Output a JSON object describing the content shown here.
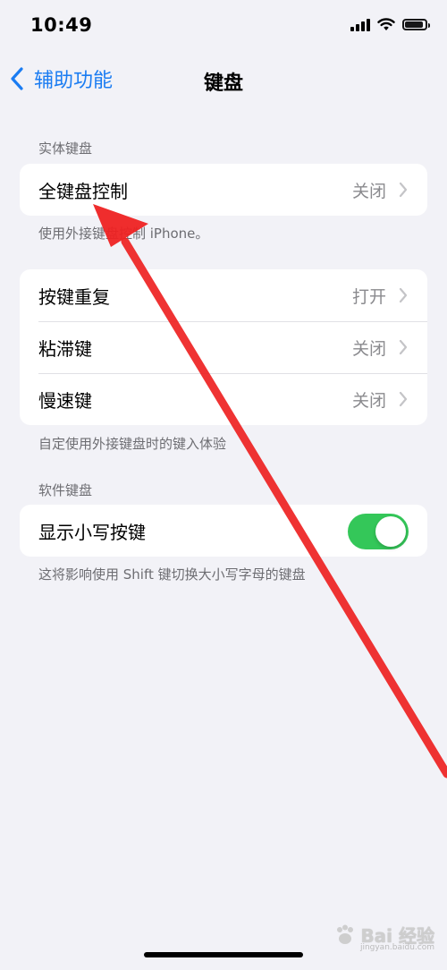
{
  "status": {
    "time": "10:49"
  },
  "nav": {
    "back_label": "辅助功能",
    "title": "键盘"
  },
  "sections": {
    "hardware": {
      "header": "实体键盘",
      "full_keyboard": {
        "label": "全键盘控制",
        "value": "关闭"
      },
      "footer": "使用外接键盘控制 iPhone。"
    },
    "keys": {
      "key_repeat": {
        "label": "按键重复",
        "value": "打开"
      },
      "sticky_keys": {
        "label": "粘滞键",
        "value": "关闭"
      },
      "slow_keys": {
        "label": "慢速键",
        "value": "关闭"
      },
      "footer": "自定使用外接键盘时的键入体验"
    },
    "software": {
      "header": "软件键盘",
      "lowercase": {
        "label": "显示小写按键",
        "enabled": true
      },
      "footer": "这将影响使用 Shift 键切换大小写字母的键盘"
    }
  },
  "watermark": {
    "brand": "Bai 经验",
    "url": "jingyan.baidu.com"
  },
  "colors": {
    "accent": "#1a7cf2",
    "toggle_on": "#34c759",
    "arrow": "#ee2222",
    "background": "#f2f2f7"
  },
  "icons": {
    "back": "chevron-left-icon",
    "disclosure": "chevron-right-icon",
    "signal": "cellular-signal-icon",
    "wifi": "wifi-icon",
    "battery": "battery-icon"
  }
}
